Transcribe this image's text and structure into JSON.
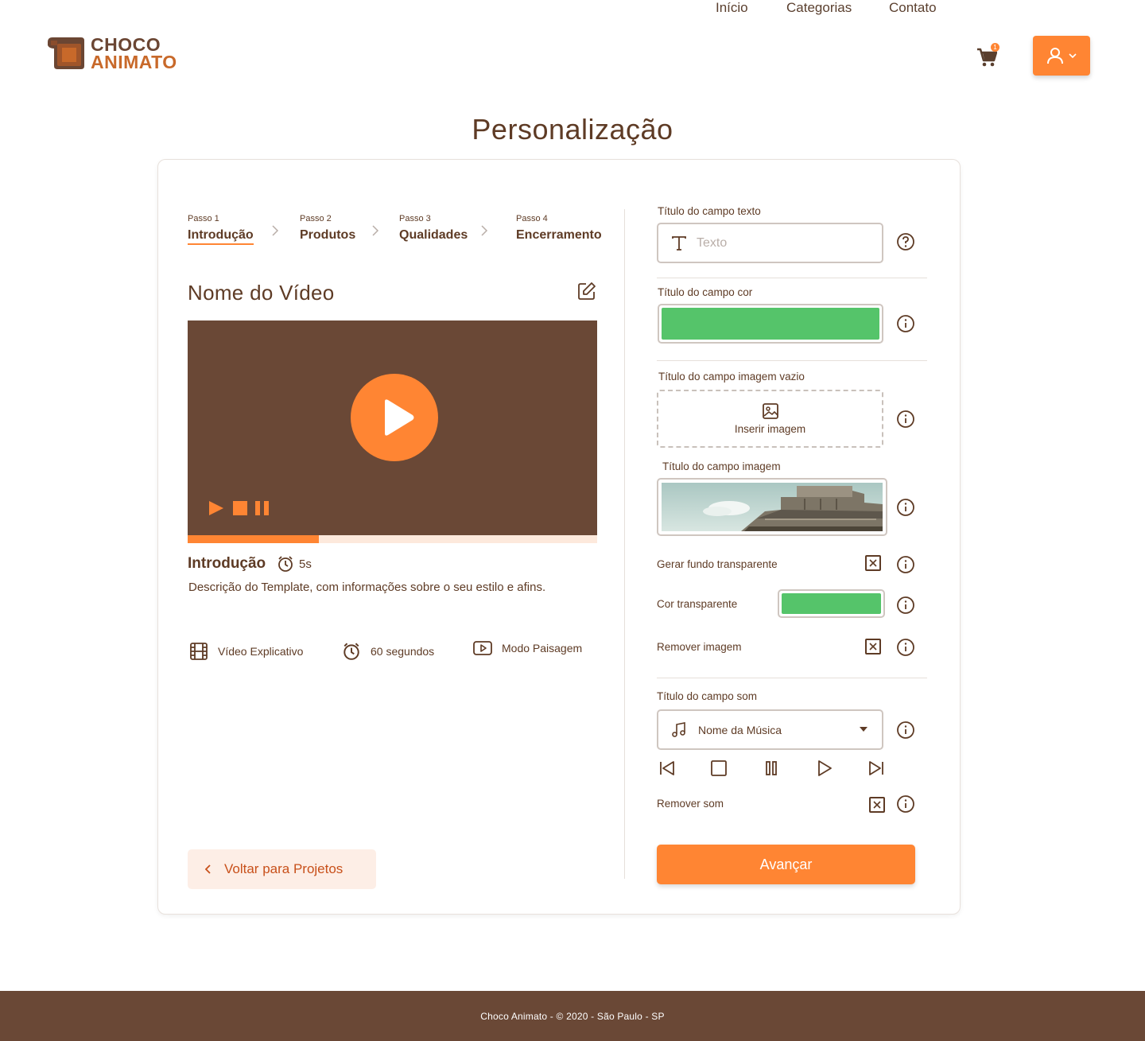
{
  "header": {
    "logo_line1": "CHOCO",
    "logo_line2": "ANIMATO",
    "nav": [
      "Início",
      "Categorias",
      "Contato"
    ],
    "cart_count": "1"
  },
  "page_title": "Personalização",
  "steps": [
    {
      "small": "Passo 1",
      "name": "Introdução",
      "active": true
    },
    {
      "small": "Passo 2",
      "name": "Produtos",
      "active": false
    },
    {
      "small": "Passo 3",
      "name": "Qualidades",
      "active": false
    },
    {
      "small": "Passo 4",
      "name": "Encerramento",
      "active": false
    }
  ],
  "video": {
    "name": "Nome do Vídeo",
    "progress_fraction": 0.32,
    "section_title": "Introdução",
    "duration": "5s",
    "description": "Descrição do Template, com informações sobre o seu estilo e afins.",
    "meta": {
      "type": "Vídeo Explicativo",
      "length": "60 segundos",
      "orientation": "Modo Paisagem"
    }
  },
  "back_button": "Voltar para Projetos",
  "form": {
    "text_label": "Título do campo texto",
    "text_placeholder": "Texto",
    "color_label": "Título do campo cor",
    "color_value": "#55c46a",
    "image_empty_label": "Título do campo imagem vazio",
    "image_insert": "Inserir imagem",
    "image_label": "Título do campo imagem",
    "transparent_bg_label": "Gerar fundo transparente",
    "transparent_color_label": "Cor transparente",
    "transparent_color_value": "#55c46a",
    "remove_image_label": "Remover imagem",
    "sound_label": "Título do campo som",
    "sound_value": "Nome da Música",
    "remove_sound_label": "Remover som",
    "advance": "Avançar"
  },
  "colors": {
    "brand": "#ff8533",
    "brown": "#6a4836",
    "text": "#5e3b25"
  },
  "footer": "Choco Animato - © 2020 - São Paulo - SP"
}
